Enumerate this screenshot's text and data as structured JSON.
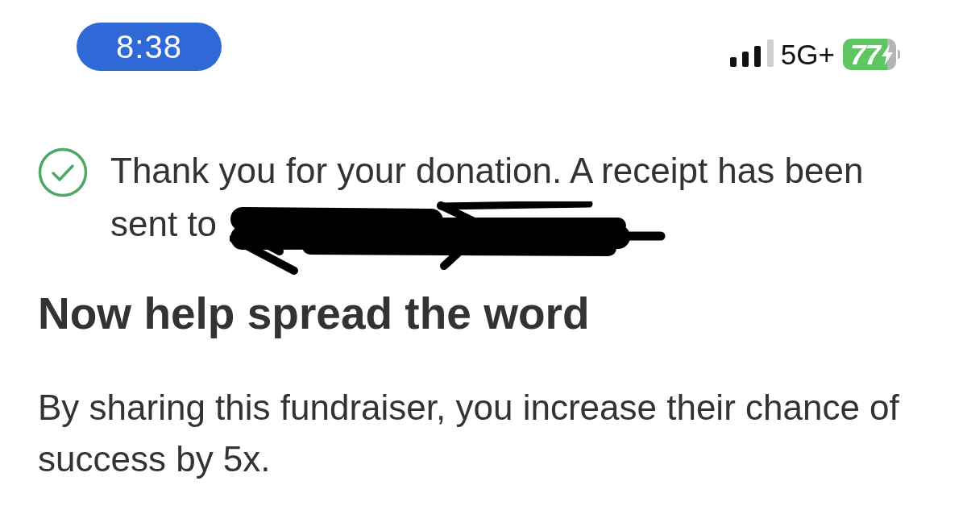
{
  "status_bar": {
    "time": "8:38",
    "network": "5G+",
    "battery": "77"
  },
  "confirmation": {
    "message_lines": [
      "Thank you for your donation. A receipt has been",
      "sent to"
    ]
  },
  "share": {
    "heading": "Now help spread the word",
    "body": "By sharing this fundraiser, you increase their chance of success by 5x."
  }
}
